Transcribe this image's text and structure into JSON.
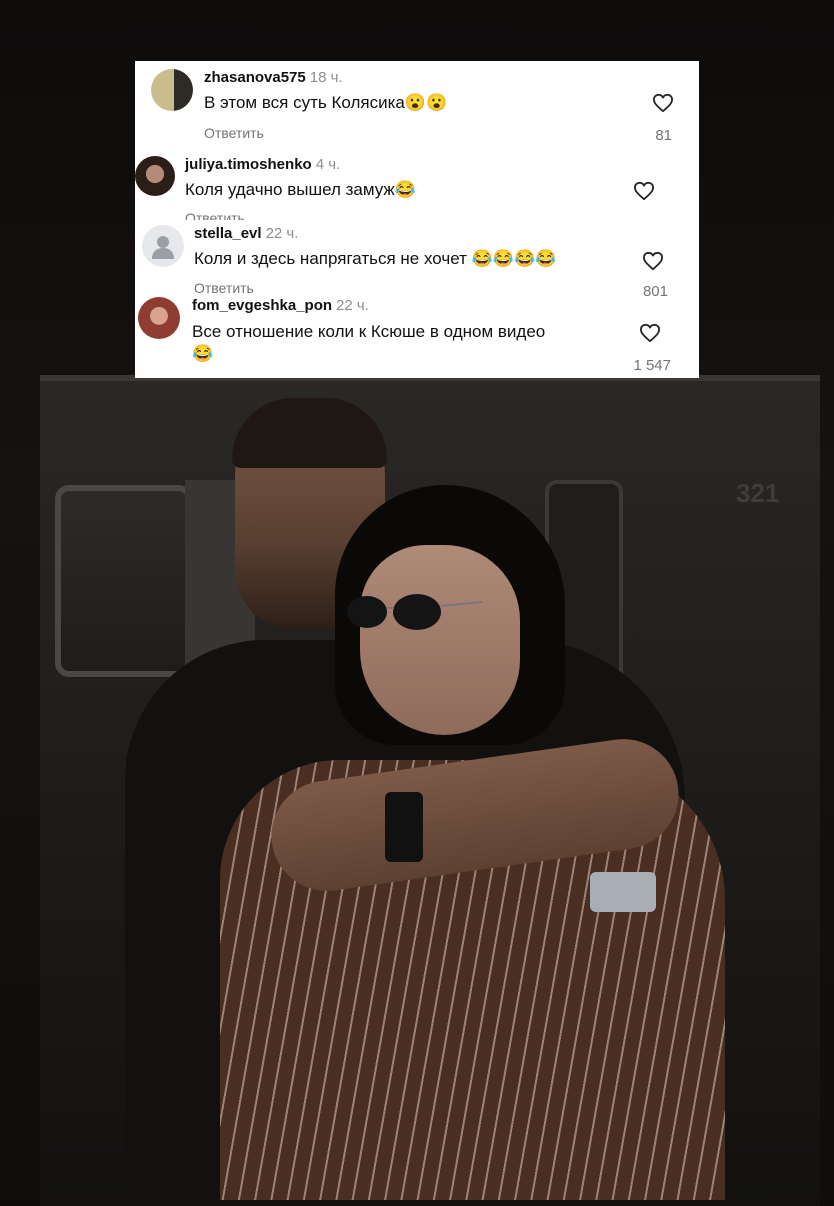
{
  "comments": [
    {
      "username": "zhasanova575",
      "time": "18 ч.",
      "text": "В этом вся суть Колясика😮😮",
      "reply_label": "Ответить",
      "likes": "81",
      "avatar_icon": "user-avatar"
    },
    {
      "username": "juliya.timoshenko",
      "time": "4 ч.",
      "text": "Коля удачно вышел замуж😂",
      "reply_label": "Ответить",
      "likes": "",
      "avatar_icon": "user-avatar"
    },
    {
      "username": "stella_evl",
      "time": "22 ч.",
      "text": "Коля и здесь напрягаться не хочет 😂😂😂😂",
      "reply_label": "Ответить",
      "likes": "801",
      "avatar_icon": "default-avatar-icon"
    },
    {
      "username": "fom_evgeshka_pon",
      "time": "22 ч.",
      "text": "Все отношение коли к Ксюше в одном видео",
      "text_line2": "😂",
      "reply_label": "",
      "likes": "1 547",
      "avatar_icon": "user-avatar"
    }
  ],
  "photo": {
    "car_number": "321"
  },
  "colors": {
    "card_bg": "#ffffff",
    "text": "#111111",
    "muted": "#737373"
  }
}
